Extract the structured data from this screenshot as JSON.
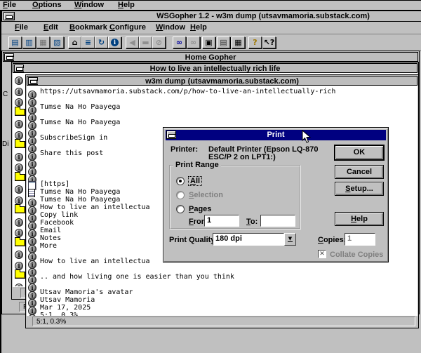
{
  "colors": {
    "accent_navy": "#000080",
    "chrome_gray": "#c0c0c0",
    "folder_yellow": "#ffff00",
    "content_white": "#ffffff"
  },
  "pm_menu": {
    "items": [
      {
        "label": "File"
      },
      {
        "label": "Options"
      },
      {
        "label": "Window"
      },
      {
        "label": "Help"
      }
    ]
  },
  "main_window": {
    "title": "WSGopher 1.2 - w3m dump (utsavmamoria.substack.com)",
    "menu": [
      {
        "label": "File"
      },
      {
        "label": "Edit"
      },
      {
        "label": "Bookmark"
      },
      {
        "label": "Configure"
      },
      {
        "label": "Window"
      },
      {
        "label": "Help"
      }
    ],
    "toolbar": [
      {
        "name": "retrieve-document",
        "glyph": "▤",
        "color": "#004080",
        "disabled": false
      },
      {
        "name": "fetch-new-item",
        "glyph": "▥",
        "color": "#004080",
        "disabled": false
      },
      {
        "name": "fetch-copy",
        "glyph": "▦",
        "color": "#707070",
        "disabled": true
      },
      {
        "name": "bookmark-document",
        "glyph": "▧",
        "color": "#004080",
        "disabled": false
      },
      {
        "name": "home-gopher",
        "glyph": "⌂",
        "color": "#000000",
        "disabled": false
      },
      {
        "name": "bookmark-list",
        "glyph": "≡",
        "color": "#004080",
        "disabled": false
      },
      {
        "name": "reload",
        "glyph": "↻",
        "color": "#004080",
        "disabled": false
      },
      {
        "name": "info",
        "glyph": "i",
        "color": "#ffffff",
        "circle": true,
        "disabled": false
      },
      {
        "name": "back",
        "glyph": "◀",
        "color": "#909090",
        "disabled": true
      },
      {
        "name": "stop",
        "glyph": "▬",
        "color": "#909090",
        "disabled": true
      },
      {
        "name": "cancel-all",
        "glyph": "⊘",
        "color": "#909090",
        "disabled": true
      },
      {
        "name": "find",
        "glyph": "∞",
        "color": "#0000a0",
        "disabled": false
      },
      {
        "name": "find-again",
        "glyph": "∞",
        "color": "#909090",
        "disabled": true
      },
      {
        "name": "save",
        "glyph": "▣",
        "color": "#000000",
        "disabled": false
      },
      {
        "name": "copy",
        "glyph": "▤",
        "color": "#333333",
        "disabled": false
      },
      {
        "name": "print",
        "glyph": "▦",
        "color": "#000000",
        "disabled": false
      },
      {
        "name": "help",
        "glyph": "?",
        "color": "#a07800",
        "disabled": false
      },
      {
        "name": "context-help",
        "glyph": "↖?",
        "color": "#000000",
        "disabled": false
      }
    ]
  },
  "home_gopher_window": {
    "title": "Home Gopher",
    "fragment_c": "C",
    "fragment_di": "Di",
    "status_fragment": "P"
  },
  "article_window": {
    "title": "How to live an intellectually rich life",
    "status_fragment": "P",
    "icons": [
      "info",
      "info",
      "info",
      "folder",
      "info",
      "info",
      "folder",
      "info",
      "info",
      "folder",
      "info",
      "info",
      "folder",
      "info",
      "info",
      "folder",
      "info",
      "info",
      "folder",
      "info"
    ]
  },
  "w3m_window": {
    "title": "w3m dump (utsavmamoria.substack.com)",
    "status": "5:1, 0.3%",
    "rows": [
      {
        "icon": "info",
        "text": "https://utsavmamoria.substack.com/p/how-to-live-an-intellectually-rich"
      },
      {
        "icon": "info",
        "text": ""
      },
      {
        "icon": "info",
        "text": "Tumse Na Ho Paayega"
      },
      {
        "icon": "info",
        "text": ""
      },
      {
        "icon": "info",
        "text": "Tumse Na Ho Paayega"
      },
      {
        "icon": "info",
        "text": ""
      },
      {
        "icon": "info",
        "text": "SubscribeSign in"
      },
      {
        "icon": "info",
        "text": ""
      },
      {
        "icon": "info",
        "text": "Share this post"
      },
      {
        "icon": "info",
        "text": ""
      },
      {
        "icon": "info",
        "text": ""
      },
      {
        "icon": "info",
        "text": ""
      },
      {
        "icon": "page",
        "text": "[https]"
      },
      {
        "icon": "doc",
        "text": "Tumse Na Ho Paayega"
      },
      {
        "icon": "info",
        "text": "Tumse Na Ho Paayega"
      },
      {
        "icon": "info",
        "text": "How to live an intellectua"
      },
      {
        "icon": "info",
        "text": "Copy link"
      },
      {
        "icon": "info",
        "text": "Facebook"
      },
      {
        "icon": "info",
        "text": "Email"
      },
      {
        "icon": "info",
        "text": "Notes"
      },
      {
        "icon": "info",
        "text": "More"
      },
      {
        "icon": "info",
        "text": ""
      },
      {
        "icon": "info",
        "text": "How to live an intellectua"
      },
      {
        "icon": "info",
        "text": ""
      },
      {
        "icon": "info",
        "text": ".. and how living one is easier than you think"
      },
      {
        "icon": "info",
        "text": ""
      },
      {
        "icon": "info",
        "text": "Utsav Mamoria's avatar"
      },
      {
        "icon": "info",
        "text": "Utsav Mamoria"
      },
      {
        "icon": "info",
        "text": "Mar 17, 2025"
      },
      {
        "icon": "info",
        "text": "5:1, 0.3%"
      }
    ]
  },
  "print_dialog": {
    "title": "Print",
    "printer_label": "Printer:",
    "printer_value_line1": "Default Printer (Epson LQ-870",
    "printer_value_line2": "ESC/P 2 on LPT1:)",
    "group_label": "Print Range",
    "radio_all": "All",
    "radio_selection": "Selection",
    "radio_pages": "Pages",
    "from_label": "From:",
    "from_value": "1",
    "to_label": "To:",
    "to_value": "",
    "quality_label_1": "Print ",
    "quality_label_2": "Quality:",
    "quality_value": "180 dpi",
    "copies_label": "Copies:",
    "copies_value": "1",
    "collate_label": "Collate Copies",
    "buttons": {
      "ok": "OK",
      "cancel": "Cancel",
      "setup": "Setup...",
      "help": "Help"
    }
  }
}
